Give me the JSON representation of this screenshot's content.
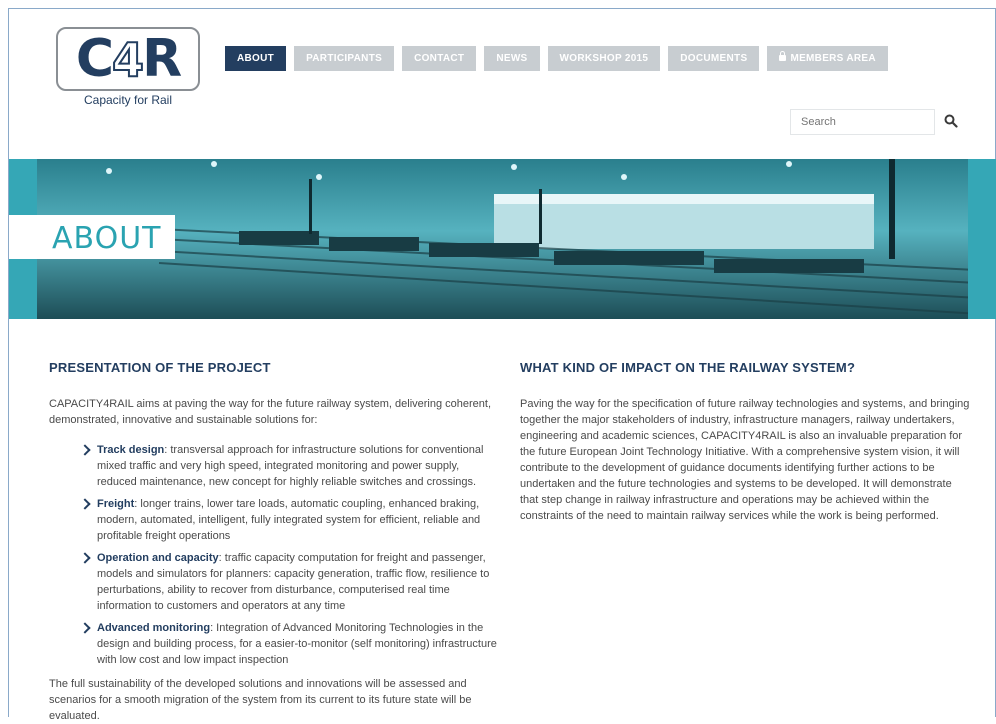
{
  "logo": {
    "mark_c": "C",
    "mark_4": "4",
    "mark_r": "R",
    "tagline": "Capacity for Rail"
  },
  "nav": {
    "items": [
      {
        "label": "ABOUT",
        "active": true
      },
      {
        "label": "PARTICIPANTS",
        "active": false
      },
      {
        "label": "CONTACT",
        "active": false
      },
      {
        "label": "NEWS",
        "active": false
      },
      {
        "label": "WORKSHOP 2015",
        "active": false
      },
      {
        "label": "DOCUMENTS",
        "active": false
      },
      {
        "label": "MEMBERS AREA",
        "active": false,
        "icon": "lock-icon"
      }
    ]
  },
  "search": {
    "placeholder": "Search",
    "icon": "search-icon"
  },
  "banner": {
    "title": "ABOUT"
  },
  "left": {
    "heading": "PRESENTATION OF THE PROJECT",
    "intro": "CAPACITY4RAIL aims at paving the way for the future railway system, delivering coherent, demonstrated, innovative and sustainable solutions for:",
    "features": [
      {
        "title": "Track design",
        "text": ": transversal approach for infrastructure solutions for conventional mixed traffic and very high speed, integrated monitoring and power supply, reduced maintenance, new concept for highly reliable switches and crossings."
      },
      {
        "title": "Freight",
        "text": ": longer trains, lower tare loads, automatic coupling, enhanced braking, modern, automated, intelligent, fully integrated system for efficient, reliable and profitable freight operations"
      },
      {
        "title": "Operation and capacity",
        "text": ": traffic capacity computation for freight and passenger, models and simulators for planners: capacity generation, traffic flow, resilience to perturbations, ability to recover from disturbance, computerised real time information to customers and operators at any time"
      },
      {
        "title": "Advanced monitoring",
        "text": ": Integration of Advanced Monitoring Technologies in the design and building process, for a easier-to-monitor (self monitoring) infrastructure with low cost and low impact inspection"
      }
    ],
    "outro": "The full sustainability of the developed solutions and innovations will be assessed and scenarios for a smooth migration of the system from its current to its future state will be evaluated."
  },
  "right": {
    "heading": "WHAT KIND OF IMPACT ON THE RAILWAY SYSTEM?",
    "text": "Paving the way for the specification of future railway technologies and systems, and bringing together the major stakeholders of industry, infrastructure managers, railway undertakers, engineering and academic sciences, CAPACITY4RAIL is also an invaluable preparation for the future European Joint Technology Initiative. With a comprehensive system vision, it will contribute to the development of guidance documents identifying further actions to be undertaken and the future technologies and systems to be developed. It will demonstrate that step change in railway infrastructure and operations may be achieved within the constraints of the need to maintain railway services while the work is being performed."
  },
  "colors": {
    "brand": "#233e60",
    "accent": "#2aa3b1",
    "nav_inactive": "#c8cdd1"
  }
}
